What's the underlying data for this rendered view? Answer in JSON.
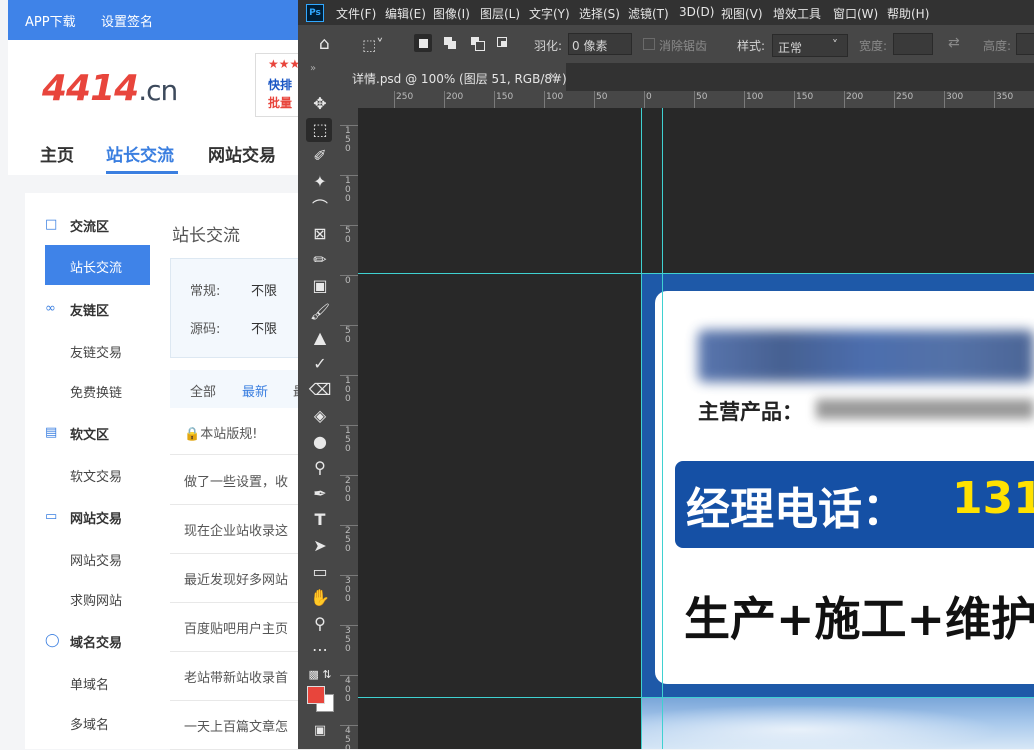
{
  "site": {
    "topbar": {
      "app_download": "APP下载",
      "settings_sign": "设置签名"
    },
    "logo_main": "4414",
    "logo_suffix": ".cn",
    "ad_line1": "★★★",
    "ad_line2": "快排",
    "ad_line3": "批量",
    "nav": [
      "主页",
      "站长交流",
      "网站交易"
    ],
    "sidebar": {
      "sections": [
        {
          "title": "交流区",
          "icon": "chat-icon"
        },
        {
          "title": "友链区",
          "icon": "link-icon"
        },
        {
          "title": "软文区",
          "icon": "document-icon"
        },
        {
          "title": "网站交易",
          "icon": "monitor-icon"
        },
        {
          "title": "域名交易",
          "icon": "globe-icon"
        }
      ],
      "active_item": "站长交流",
      "items": [
        "友链交易",
        "免费换链",
        "软文交易",
        "网站交易",
        "求购网站",
        "单域名",
        "多域名"
      ]
    },
    "main": {
      "title": "站长交流",
      "filter_normal_label": "常规:",
      "filter_normal_value": "不限",
      "filter_source_label": "源码:",
      "filter_source_value": "不限",
      "tab_all": "全部",
      "tab_latest": "最新",
      "tab_more": "最",
      "rule_notice": "本站版规!",
      "posts": [
        "做了一些设置，收",
        "现在企业站收录这",
        "最近发现好多网站",
        "百度贴吧用户主页",
        "老站带新站收录首",
        "一天上百篇文章怎"
      ]
    }
  },
  "ps": {
    "logo": "Ps",
    "menu": [
      "文件(F)",
      "编辑(E)",
      "图像(I)",
      "图层(L)",
      "文字(Y)",
      "选择(S)",
      "滤镜(T)",
      "3D(D)",
      "视图(V)",
      "增效工具",
      "窗口(W)",
      "帮助(H)"
    ],
    "options": {
      "feather_label": "羽化:",
      "feather_value": "0 像素",
      "antialias_label": "消除锯齿",
      "style_label": "样式:",
      "style_value": "正常",
      "width_label": "宽度:",
      "height_label": "高度:"
    },
    "doc_tab": "详情.psd @ 100% (图层 51, RGB/8#)",
    "ruler_top": [
      "250",
      "200",
      "150",
      "100",
      "50",
      "0",
      "50",
      "100",
      "150",
      "200",
      "250",
      "300",
      "350"
    ],
    "ruler_left": [
      "1\n5\n0",
      "1\n0\n0",
      "5\n0",
      "0",
      "5\n0",
      "1\n0\n0",
      "1\n5\n0",
      "2\n0\n0",
      "2\n5\n0",
      "3\n0\n0",
      "3\n5\n0",
      "4\n0\n0",
      "4\n5\n0"
    ],
    "design": {
      "product_label": "主营产品：",
      "phone_label": "经理电话：",
      "phone_number": "131",
      "slogan": "生产+施工+维护"
    },
    "colors": {
      "foreground": "#e8453c",
      "background": "#ffffff",
      "guide": "#3fd1d1"
    }
  }
}
